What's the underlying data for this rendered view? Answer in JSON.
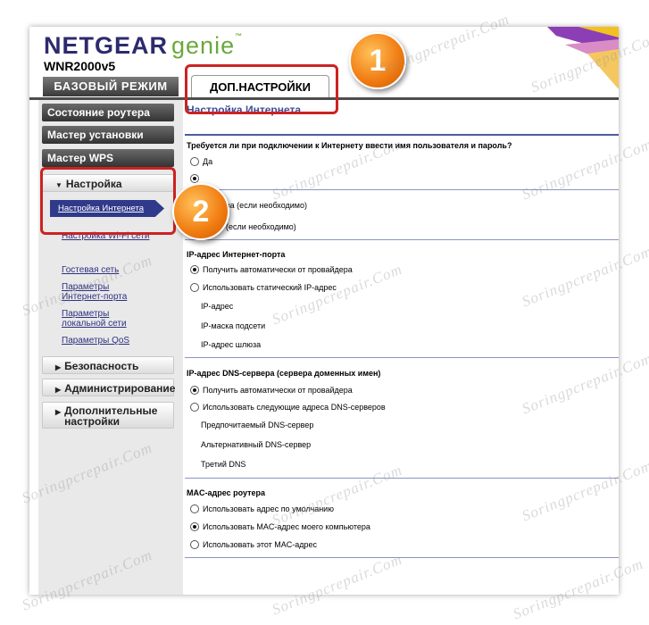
{
  "brand": {
    "name": "NETGEAR",
    "product": "genie",
    "tm": "™",
    "model": "WNR2000v5"
  },
  "tabs": {
    "basic": "БАЗОВЫЙ РЕЖИМ",
    "advanced": "ДОП.НАСТРОЙКИ"
  },
  "sidebar": {
    "router_status": "Состояние роутера",
    "setup_wizard": "Мастер установки",
    "wps_wizard": "Мастер WPS",
    "setup_section": "Настройка",
    "items": {
      "internet": "Настройка Интернета",
      "wifi": "Настройка Wi-Fi сети",
      "guest": "Гостевая сеть",
      "wan_port_1": "Параметры",
      "wan_port_2": "Интернет-порта",
      "lan_1": "Параметры",
      "lan_2": "локальной сети",
      "qos": "Параметры QoS"
    },
    "security": "Безопасность",
    "admin": "Администрирование",
    "advanced_1": "Дополнительные",
    "advanced_2": "настройки"
  },
  "content": {
    "title": "Настройка Интернета",
    "login_question": "Требуется ли при подключении к Интернету ввести имя пользователя и пароль?",
    "yes": "Да",
    "account_name_suffix": "ва  (если необходимо)",
    "domain_name_suffix": "(если необходимо)",
    "ip_section": "IP-адрес Интернет-порта",
    "ip_auto": "Получить автоматически от провайдера",
    "ip_static": "Использовать статический IP-адрес",
    "ip_address": "IP-адрес",
    "ip_mask": "IP-маска подсети",
    "ip_gateway": "IP-адрес шлюза",
    "dns_section": "IP-адрес DNS-сервера (сервера доменных имен)",
    "dns_auto": "Получить автоматически от провайдера",
    "dns_manual": "Использовать следующие адреса DNS-серверов",
    "dns_primary": "Предпочитаемый DNS-сервер",
    "dns_secondary": "Альтернативный DNS-сервер",
    "dns_third": "Третий DNS",
    "mac_section": "MAC-адрес роутера",
    "mac_default": "Использовать адрес по умолчанию",
    "mac_computer": "Использовать MAC-адрес моего компьютера",
    "mac_this": "Использовать этот MAC-адрес"
  },
  "annotations": {
    "badge1": "1",
    "badge2": "2"
  },
  "watermark": "Soringpcrepair.Com",
  "colors": {
    "highlight": "#cc2222",
    "badge": "#f07a10",
    "nav_dark": "#3a3a3a",
    "accent_blue": "#2f3a8a"
  }
}
